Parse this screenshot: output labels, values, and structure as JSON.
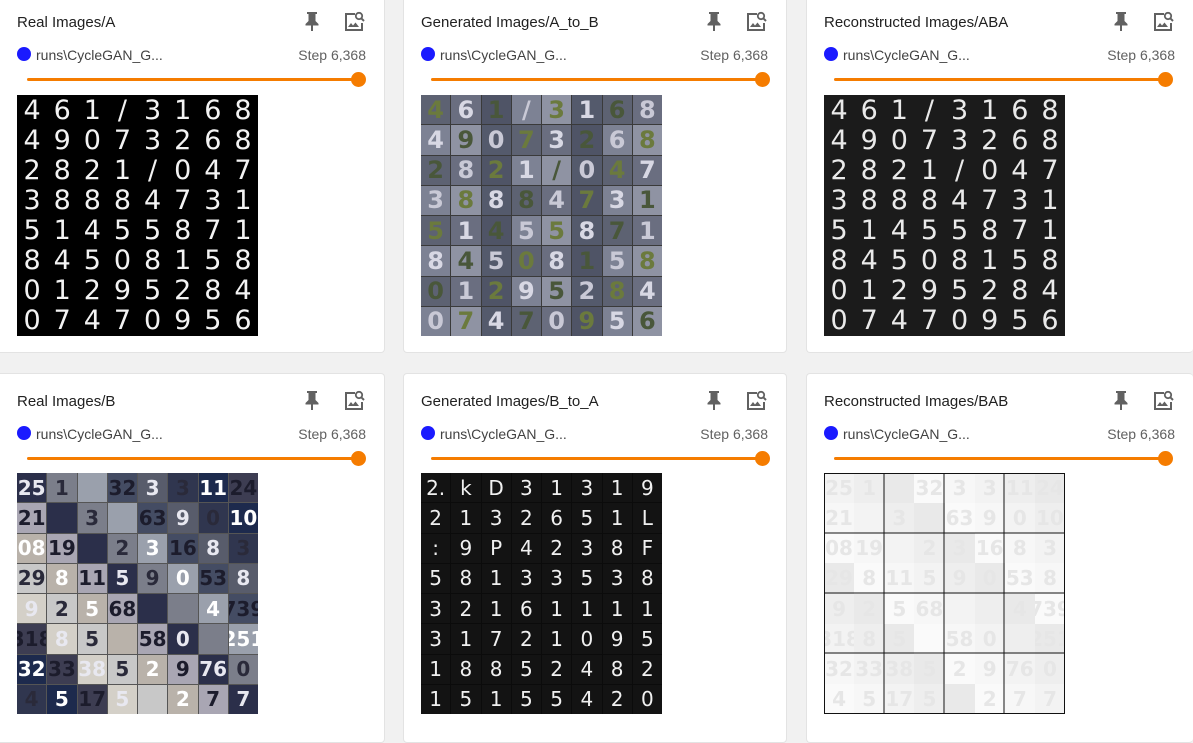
{
  "accent_color": "#f57c00",
  "run_color": "#1a1aff",
  "cards": [
    {
      "title": "Real Images/A",
      "run": "runs\\CycleGAN_G...",
      "step": "Step 6,368",
      "icons": [
        "pin-icon",
        "image-search-icon"
      ]
    },
    {
      "title": "Generated Images/A_to_B",
      "run": "runs\\CycleGAN_G...",
      "step": "Step 6,368",
      "icons": [
        "pin-icon",
        "image-search-icon"
      ]
    },
    {
      "title": "Reconstructed Images/ABA",
      "run": "runs\\CycleGAN_G...",
      "step": "Step 6,368",
      "icons": [
        "pin-icon",
        "image-search-icon"
      ]
    },
    {
      "title": "Real Images/B",
      "run": "runs\\CycleGAN_G...",
      "step": "Step 6,368",
      "icons": [
        "pin-icon",
        "image-search-icon"
      ]
    },
    {
      "title": "Generated Images/B_to_A",
      "run": "runs\\CycleGAN_G...",
      "step": "Step 6,368",
      "icons": [
        "pin-icon",
        "image-search-icon"
      ]
    },
    {
      "title": "Reconstructed Images/BAB",
      "run": "runs\\CycleGAN_G...",
      "step": "Step 6,368",
      "icons": [
        "pin-icon",
        "image-search-icon"
      ]
    }
  ],
  "step_slider_position": 1.0,
  "images": {
    "real_a_digits": [
      [
        "4",
        "6",
        "1",
        "/",
        "3",
        "1",
        "6",
        "8"
      ],
      [
        "4",
        "9",
        "0",
        "7",
        "3",
        "2",
        "6",
        "8"
      ],
      [
        "2",
        "8",
        "2",
        "1",
        "/",
        "0",
        "4",
        "7"
      ],
      [
        "3",
        "8",
        "8",
        "8",
        "4",
        "7",
        "3",
        "1"
      ],
      [
        "5",
        "1",
        "4",
        "5",
        "5",
        "8",
        "7",
        "1"
      ],
      [
        "8",
        "4",
        "5",
        "0",
        "8",
        "1",
        "5",
        "8"
      ],
      [
        "0",
        "1",
        "2",
        "9",
        "5",
        "2",
        "8",
        "4"
      ],
      [
        "0",
        "7",
        "4",
        "7",
        "0",
        "9",
        "5",
        "6"
      ]
    ],
    "real_b_digits": [
      [
        "25",
        "1",
        "",
        "32",
        "3",
        "3",
        "11",
        "24"
      ],
      [
        "21",
        "",
        "3",
        "",
        "63",
        "9",
        "0",
        "10"
      ],
      [
        "08",
        "19",
        "",
        "2",
        "3",
        "16",
        "8",
        "3"
      ],
      [
        "29",
        "8",
        "11",
        "5",
        "9",
        "0",
        "53",
        "8"
      ],
      [
        "9",
        "2",
        "5",
        "68",
        "",
        "",
        "4",
        "739"
      ],
      [
        "318",
        "8",
        "5",
        "",
        "58",
        "0",
        "",
        "251"
      ],
      [
        "32",
        "33",
        "38",
        "5",
        "2",
        "9",
        "76",
        "0"
      ],
      [
        "4",
        "5",
        "17",
        "5",
        "",
        "2",
        "7",
        "7"
      ]
    ],
    "gen_ba_glyphs": [
      [
        "2.",
        "k",
        "D",
        "3",
        "1",
        "3",
        "1",
        "9"
      ],
      [
        "2",
        "1",
        "3",
        "2",
        "6",
        "5",
        "1",
        "L"
      ],
      [
        ":",
        "9",
        "P",
        "4",
        "2",
        "3",
        "8",
        "F"
      ],
      [
        "5",
        "8",
        "1",
        "3",
        "3",
        "5",
        "3",
        "8"
      ],
      [
        "3",
        "2",
        "1",
        "6",
        "1",
        "1",
        "1",
        "1"
      ],
      [
        "3",
        "1",
        "7",
        "2",
        "1",
        "0",
        "9",
        "5"
      ],
      [
        "1",
        "8",
        "8",
        "5",
        "2",
        "4",
        "8",
        "2"
      ],
      [
        "1",
        "5",
        "1",
        "5",
        "5",
        "4",
        "2",
        "0"
      ]
    ]
  }
}
